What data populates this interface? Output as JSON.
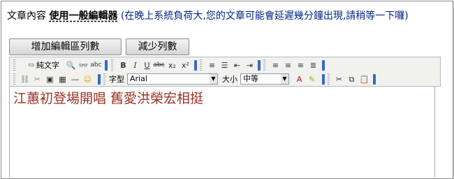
{
  "heading": {
    "label": "文章內容",
    "editor_mode": "使用一般編輯器",
    "note": " (在晚上系統負荷大,您的文章可能會延遲幾分鐘出現,請稍等一下囉)"
  },
  "buttons": {
    "add_rows": "增加編輯區列數",
    "remove_rows": "減少列數"
  },
  "toolbar": {
    "plain_text_label": "純文字",
    "font_label": "字型",
    "font_value": "Arial",
    "size_label": "大小",
    "size_value": "中等"
  },
  "editor": {
    "content": "江蕙初登場開唱 舊愛洪榮宏相挺"
  },
  "colors": {
    "note": "#00238a",
    "editor_text": "#993322",
    "separator": "#3b67c6"
  }
}
